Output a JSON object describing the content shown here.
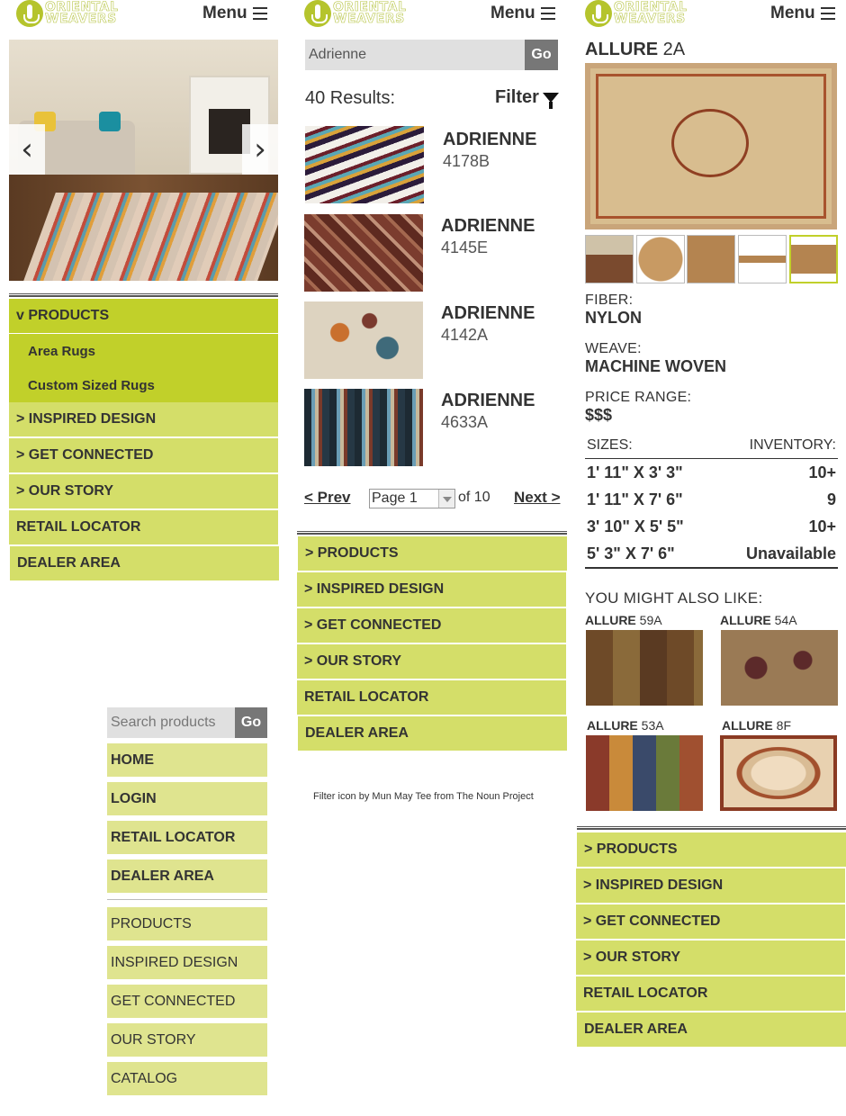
{
  "brand": {
    "line1": "ORIENTAL",
    "line2": "WEAVERS"
  },
  "header": {
    "menu_label": "Menu"
  },
  "panel1": {
    "nav": [
      "v PRODUCTS",
      "Area Rugs",
      "Custom Sized Rugs",
      "> INSPIRED DESIGN",
      "> GET CONNECTED",
      "> OUR STORY",
      "RETAIL LOCATOR",
      "DEALER AREA"
    ]
  },
  "panel2": {
    "search_value": "Adrienne",
    "go_label": "Go",
    "results_text": "40 Results:",
    "filter_label": "Filter",
    "results": [
      {
        "name": "ADRIENNE",
        "code": "4178B"
      },
      {
        "name": "ADRIENNE",
        "code": "4145E"
      },
      {
        "name": "ADRIENNE",
        "code": "4142A"
      },
      {
        "name": "ADRIENNE",
        "code": "4633A"
      }
    ],
    "pager": {
      "prev": "< Prev",
      "page_select": "Page 1",
      "of_text": "of 10",
      "next": "Next >"
    },
    "nav": [
      "> PRODUCTS",
      "> INSPIRED DESIGN",
      "> GET CONNECTED",
      "> OUR STORY",
      "RETAIL LOCATOR",
      "DEALER AREA"
    ],
    "credit": "Filter icon by Mun May Tee from The Noun Project"
  },
  "panel3": {
    "title_name": "ALLURE",
    "title_code": "2A",
    "fiber_label": "FIBER:",
    "fiber_value": "NYLON",
    "weave_label": "WEAVE:",
    "weave_value": "MACHINE WOVEN",
    "price_label": "PRICE RANGE:",
    "price_value": "$$$",
    "sizes_header": "SIZES:",
    "inventory_header": "INVENTORY:",
    "inventory": [
      {
        "size": "1' 11\" X 3' 3\"",
        "qty": "10+"
      },
      {
        "size": "1' 11\" X 7' 6\"",
        "qty": "9"
      },
      {
        "size": "3' 10\" X 5' 5\"",
        "qty": "10+"
      },
      {
        "size": "5' 3\" X 7' 6\"",
        "qty": "Unavailable"
      }
    ],
    "also_like_label": "YOU MIGHT ALSO LIKE:",
    "recommendations": [
      {
        "name": "ALLURE",
        "code": "59A"
      },
      {
        "name": "ALLURE",
        "code": "54A"
      },
      {
        "name": "ALLURE",
        "code": "53A"
      },
      {
        "name": "ALLURE",
        "code": "8F"
      }
    ],
    "nav": [
      "> PRODUCTS",
      "> INSPIRED DESIGN",
      "> GET CONNECTED",
      "> OUR STORY",
      "RETAIL LOCATOR",
      "DEALER AREA"
    ]
  },
  "mobile_menu": {
    "search_placeholder": "Search products",
    "go_label": "Go",
    "primary": [
      "HOME",
      "LOGIN",
      "RETAIL LOCATOR",
      "DEALER AREA"
    ],
    "secondary": [
      "PRODUCTS",
      "INSPIRED DESIGN",
      "GET CONNECTED",
      "OUR STORY",
      "CATALOG"
    ]
  },
  "colors": {
    "accent": "#c1d02a",
    "nav": "#d4de69",
    "text": "#333333"
  }
}
